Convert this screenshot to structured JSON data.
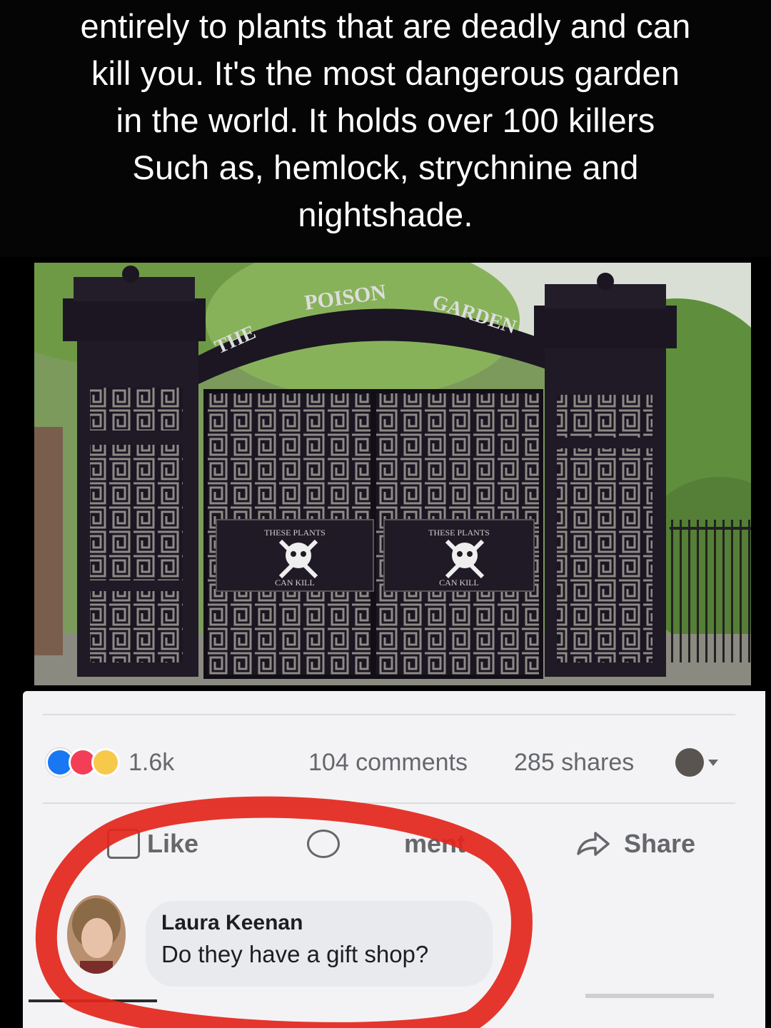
{
  "caption": {
    "lines": [
      "entirely to plants that are deadly and can",
      "kill you. It's the most dangerous garden",
      "in the world. It holds over 100 killers",
      "Such as, hemlock, strychnine and",
      "nightshade."
    ]
  },
  "photo": {
    "arch_text_left": "THE",
    "arch_text_mid": "POISON",
    "arch_text_right": "GARDEN",
    "sign_left_top": "THESE PLANTS",
    "sign_left_bottom": "CAN KILL",
    "sign_right_top": "THESE PLANTS",
    "sign_right_bottom": "CAN KILL"
  },
  "reactions": {
    "count": "1.6k",
    "comments": "104 comments",
    "shares": "285 shares"
  },
  "actions": {
    "like": "Like",
    "comment": "ment",
    "share": "Share"
  },
  "comment": {
    "author": "Laura Keenan",
    "text": "Do they have a gift shop?"
  },
  "colors": {
    "like_blue": "#1877f2",
    "annotation_red": "#e3261b",
    "caption_bg": "#050505"
  }
}
